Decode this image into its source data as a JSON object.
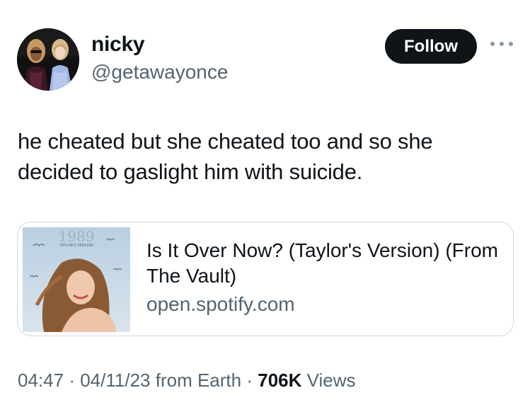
{
  "author": {
    "display_name": "nicky",
    "handle": "@getawayonce"
  },
  "follow_button": {
    "label": "Follow"
  },
  "tweet": {
    "text": "he cheated but she cheated too and so she decided to gaslight him with suicide."
  },
  "link_card": {
    "title": "Is It Over Now? (Taylor's Version) (From The Vault)",
    "domain": "open.spotify.com",
    "thumbnail_text": "1989",
    "thumbnail_subtext": "TAYLOR'S VERSION"
  },
  "meta": {
    "time": "04:47",
    "date": "04/11/23",
    "source": "from Earth",
    "views_count": "706K",
    "views_label": "Views",
    "separator": "·"
  },
  "icons": {
    "more": "more-horizontal-icon"
  },
  "colors": {
    "follow_bg": "#0f1419",
    "secondary_text": "#536471",
    "card_border": "#cfd9de"
  }
}
